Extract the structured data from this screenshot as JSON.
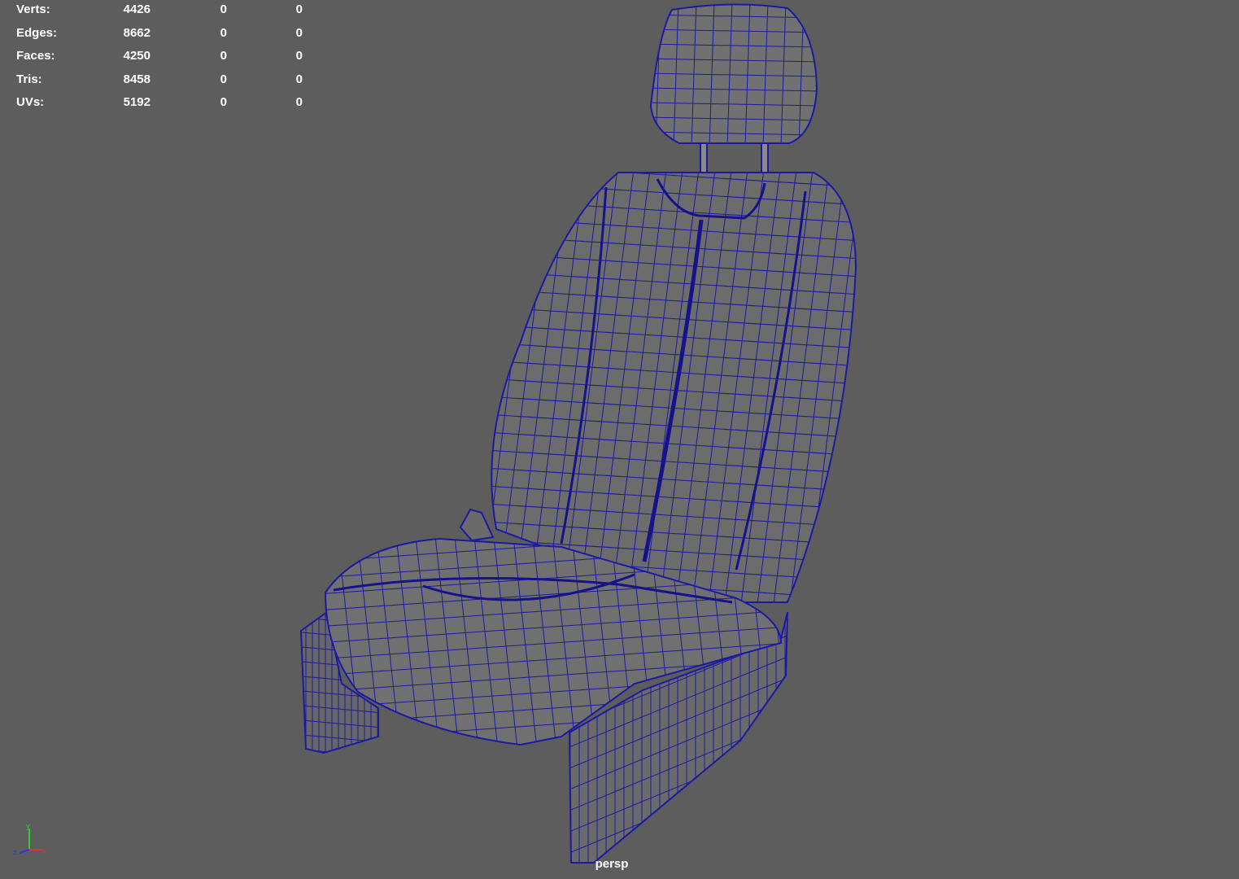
{
  "viewport": {
    "camera": "persp",
    "background_color": "#5d5d5d",
    "wire_color": "#1c1aa0",
    "surface_color": "#6e6e6e"
  },
  "hud": {
    "rows": [
      {
        "label": "Verts:",
        "v1": "4426",
        "v2": "0",
        "v3": "0"
      },
      {
        "label": "Edges:",
        "v1": "8662",
        "v2": "0",
        "v3": "0"
      },
      {
        "label": "Faces:",
        "v1": "4250",
        "v2": "0",
        "v3": "0"
      },
      {
        "label": "Tris:",
        "v1": "8458",
        "v2": "0",
        "v3": "0"
      },
      {
        "label": "UVs:",
        "v1": "5192",
        "v2": "0",
        "v3": "0"
      }
    ]
  },
  "axis_gizmo": {
    "x": "x",
    "y": "y",
    "z": "z"
  }
}
